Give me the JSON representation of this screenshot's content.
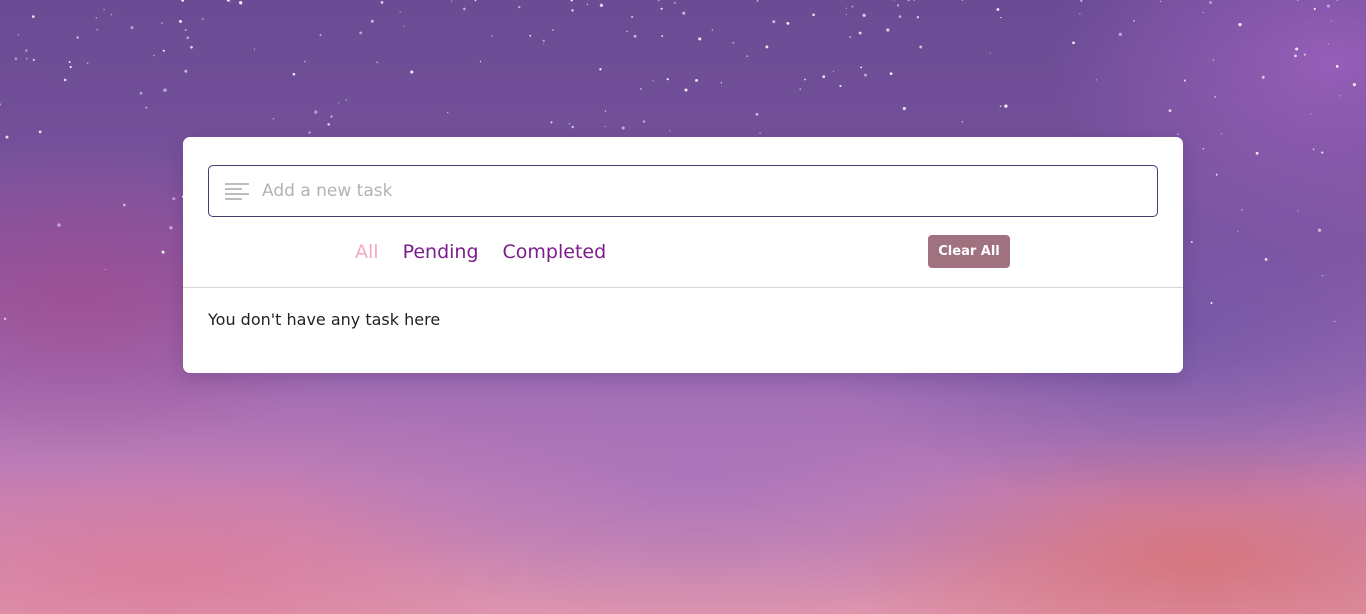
{
  "task_input": {
    "placeholder": "Add a new task",
    "value": "",
    "icon": "menu-lines-icon"
  },
  "filters": {
    "tabs": [
      {
        "label": "All",
        "active": true
      },
      {
        "label": "Pending",
        "active": false
      },
      {
        "label": "Completed",
        "active": false
      }
    ]
  },
  "toolbar": {
    "clear_all_label": "Clear All"
  },
  "task_list": {
    "empty_message": "You don't have any task here"
  },
  "colors": {
    "active_tab": "#f5a8c0",
    "inactive_tab": "#7c1d8c",
    "clear_button": "#a0717e",
    "input_border": "#4a3a6e"
  }
}
